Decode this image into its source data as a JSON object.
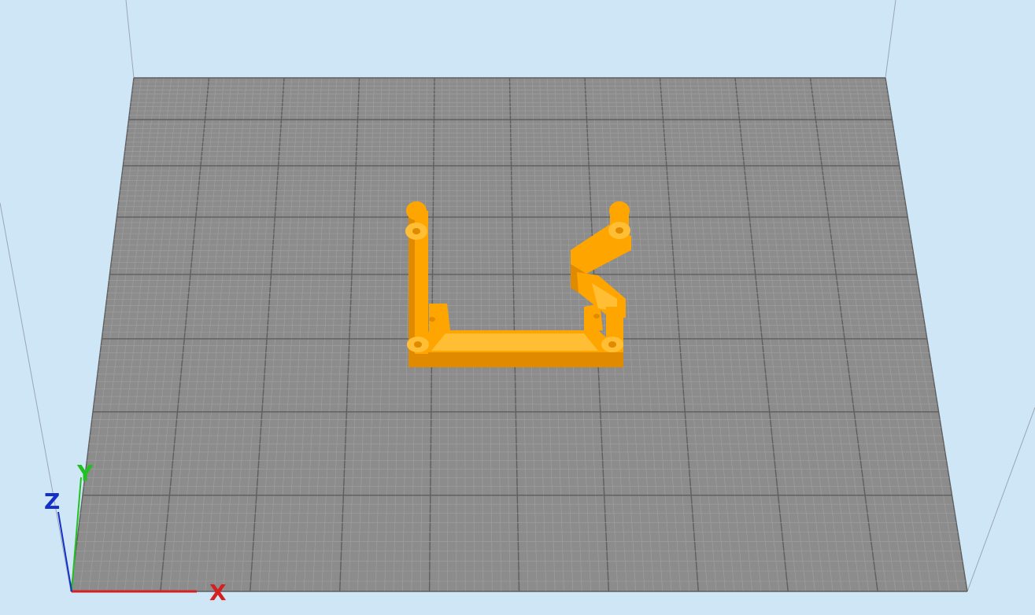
{
  "viewport": {
    "background_color": "#cfe6f7",
    "bed_color": "#8c8c8c",
    "grid_minor_color": "#9e9e9e",
    "grid_major_color": "#5e5e5e",
    "model_color": "#ffa500",
    "model_shadow_color": "#e08a00",
    "model_highlight_color": "#ffbe33"
  },
  "axes": {
    "x_label": "X",
    "y_label": "Y",
    "z_label": "Z",
    "x_color": "#d42020",
    "y_color": "#22c022",
    "z_color": "#1530c8"
  },
  "icons": {
    "model": "3d-model-icon",
    "axes": "axis-gizmo-icon"
  }
}
